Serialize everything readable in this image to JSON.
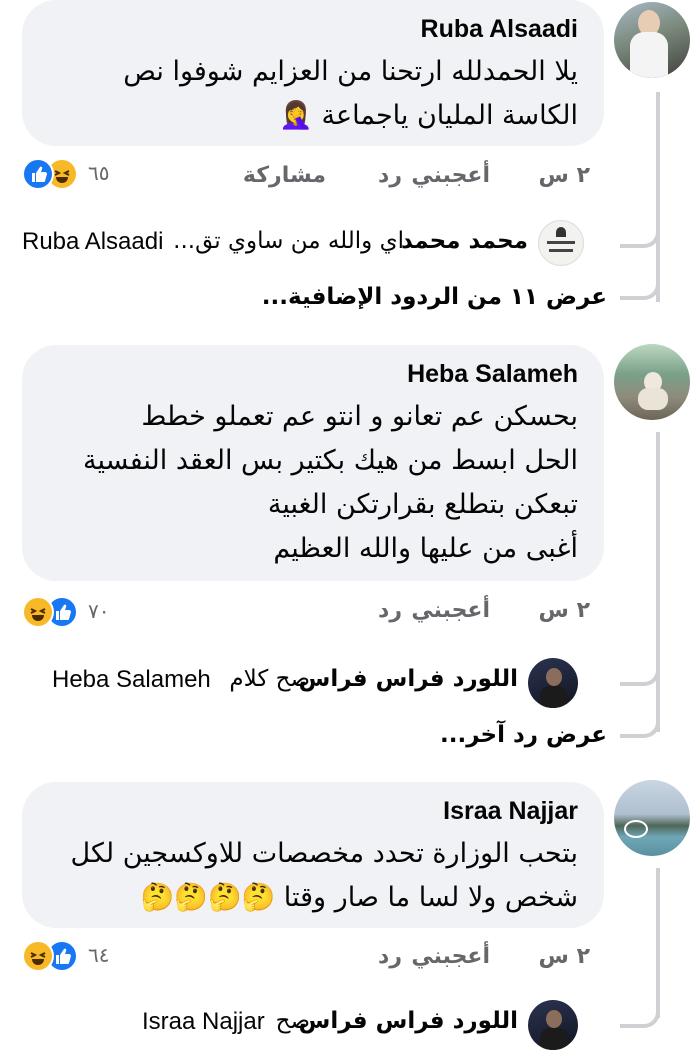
{
  "colors": {
    "bubble_bg": "#f0f2f5",
    "secondary_text": "#65676b",
    "like_blue": "#1877f2",
    "haha_yellow": "#f7b928",
    "thread_line": "#ced0d4"
  },
  "comments": [
    {
      "author": "Ruba Alsaadi",
      "lines": [
        "يلا الحمدلله ارتحنا من العزايم شوفوا نص",
        "الكاسة المليان ياجماعة 🤦‍♀️"
      ],
      "time": "٢ س",
      "like": "أعجبني",
      "reply": "رد",
      "share": "مشاركة",
      "reaction_icons": [
        "like-icon",
        "haha-icon"
      ],
      "reaction_count": "٦٥",
      "reply_preview": {
        "name": "محمد محمد",
        "text": "اي والله من ساوي تق...",
        "mention": "Ruba Alsaadi"
      },
      "more_replies": "عرض ١١ من الردود الإضافية..."
    },
    {
      "author": "Heba Salameh",
      "lines": [
        "بحسكن عم تعانو و انتو عم تعملو خطط",
        "الحل ابسط من هيك بكتير بس العقد النفسية",
        "تبعكن بتطلع بقرارتكن الغبية",
        "أغبى من عليها والله العظيم"
      ],
      "time": "٢ س",
      "like": "أعجبني",
      "reply": "رد",
      "reaction_icons": [
        "haha-icon",
        "like-icon"
      ],
      "reaction_count": "٧٠",
      "reply_preview": {
        "name": "اللورد فراس فراس",
        "text": "صح كلام",
        "mention": "Heba Salameh"
      },
      "more_replies": "عرض رد آخر..."
    },
    {
      "author": "Israa Najjar",
      "lines": [
        "بتحب الوزارة تحدد مخصصات للاوكسجين لكل",
        "شخص ولا لسا ما صار وقتا 🤔🤔🤔🤔"
      ],
      "time": "٢ س",
      "like": "أعجبني",
      "reply": "رد",
      "reaction_icons": [
        "haha-icon",
        "like-icon"
      ],
      "reaction_count": "٦٤",
      "reply_preview": {
        "name": "اللورد فراس فراس",
        "text": "صح",
        "mention": "Israa Najjar"
      }
    }
  ]
}
